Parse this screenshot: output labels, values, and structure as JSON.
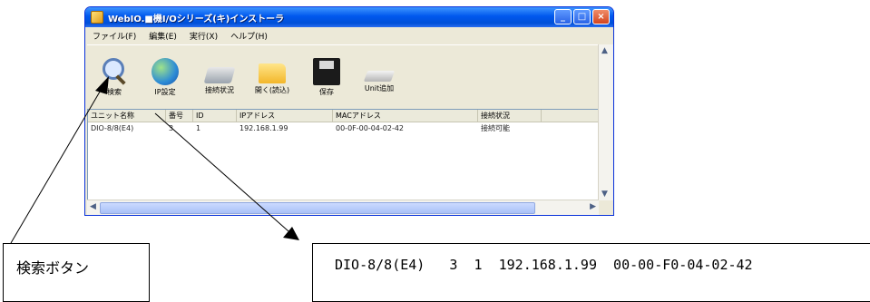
{
  "window": {
    "title": "WebIO.■機I/Oシリーズ(キ)インストーラ",
    "title_buttons": {
      "minimize": "_",
      "maximize": "□",
      "close": "×"
    }
  },
  "menu": [
    "ファイル(F)",
    "編集(E)",
    "実行(X)",
    "ヘルプ(H)"
  ],
  "toolbar": [
    {
      "label": "検索",
      "icon": "search-icon"
    },
    {
      "label": "IP設定",
      "icon": "globe-icon"
    },
    {
      "label": "接続状況",
      "icon": "network-icon"
    },
    {
      "label": "開く(読込)",
      "icon": "folder-icon"
    },
    {
      "label": "保存",
      "icon": "save-icon"
    },
    {
      "label": "Unit追加",
      "icon": "unit-icon"
    }
  ],
  "table": {
    "columns": [
      "ユニット名称",
      "番号",
      "ID",
      "IPアドレス",
      "MACアドレス",
      "接続状況"
    ],
    "rows": [
      [
        "DIO-8/8(E4)",
        "3",
        "1",
        "192.168.1.99",
        "00-0F-00-04-02-42",
        "接続可能"
      ]
    ]
  },
  "callouts": {
    "search_button": "検索ボタン",
    "row_detail": "DIO-8/8(E4)   3  1  192.168.1.99  00-00-F0-04-02-42"
  },
  "colors": {
    "title_bar": "#0058ee",
    "window_bg": "#ece9d8"
  }
}
